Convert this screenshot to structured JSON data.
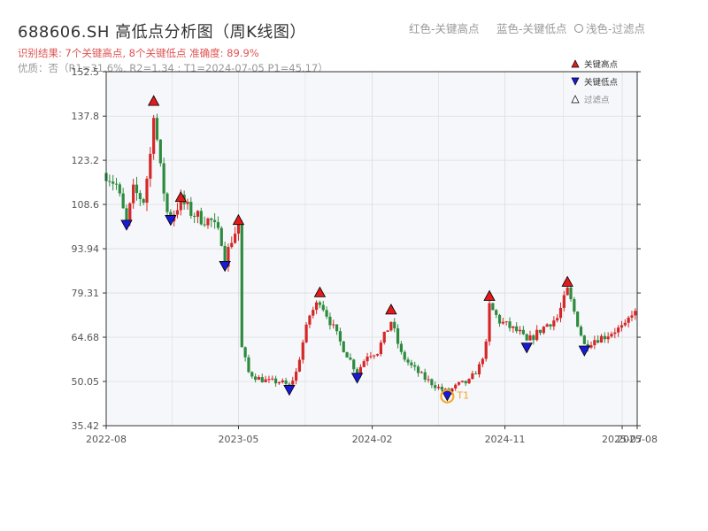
{
  "title": "688606.SH 高低点分析图（周K线图）",
  "result_line": "识别结果: 7个关键高点, 8个关键低点  准确度: 89.9%",
  "quality_line": "优质：否（R1=31.6%, R2=1.34 ; T1=2024-07-05 P1=45.17）",
  "top_legend": {
    "red": "红色-关键高点",
    "blue": "蓝色-关键低点",
    "light": "浅色-过滤点"
  },
  "colors": {
    "up": "#d62728",
    "down": "#2e8b3e",
    "high_marker": "#e31a1c",
    "low_marker": "#1a1ad6",
    "t1_ring": "#f5a623",
    "plot_bg": "#f5f7fa",
    "grid": "#dddddd"
  },
  "chart_data": {
    "type": "candlestick",
    "title": "688606.SH 高低点分析图（周K线图）",
    "x_ticks": [
      "2022-08",
      "2023-05",
      "2024-02",
      "2024-11",
      "2025-07",
      "2025-08"
    ],
    "x_tick_dates": [
      "2022-08-01",
      "2023-05-01",
      "2024-02-01",
      "2024-11-01",
      "2025-07-01",
      "2025-08-01"
    ],
    "x_range": [
      "2022-08-01",
      "2025-08-01"
    ],
    "y_ticks": [
      "35.42",
      "50.05",
      "64.68",
      "79.31",
      "93.94",
      "108.6",
      "123.2",
      "137.8",
      "152.5"
    ],
    "ylim": [
      35.42,
      152.5
    ],
    "legend": [
      {
        "label": "关键高点",
        "marker": "triangle-up",
        "color": "#e31a1c"
      },
      {
        "label": "关键低点",
        "marker": "triangle-down",
        "color": "#1a1ad6"
      },
      {
        "label": "过滤点",
        "marker": "triangle-up-open",
        "color": "#ffffff"
      }
    ],
    "legend_position": "top-right",
    "grid": true,
    "key_highs": [
      {
        "date": "2022-11-07",
        "value": 142.8
      },
      {
        "date": "2023-01-02",
        "value": 111.0
      },
      {
        "date": "2023-05-01",
        "value": 103.4
      },
      {
        "date": "2023-10-16",
        "value": 79.5
      },
      {
        "date": "2024-03-11",
        "value": 73.8
      },
      {
        "date": "2024-09-30",
        "value": 78.3
      },
      {
        "date": "2025-03-10",
        "value": 83.0
      }
    ],
    "key_lows": [
      {
        "date": "2022-09-12",
        "value": 101.6
      },
      {
        "date": "2022-12-12",
        "value": 103.2
      },
      {
        "date": "2023-04-03",
        "value": 88.0
      },
      {
        "date": "2023-08-14",
        "value": 47.0
      },
      {
        "date": "2024-01-01",
        "value": 51.0
      },
      {
        "date": "2024-07-05",
        "value": 45.17
      },
      {
        "date": "2024-12-16",
        "value": 61.0
      },
      {
        "date": "2025-04-14",
        "value": 60.0
      }
    ],
    "t1": {
      "label": "T1",
      "date": "2024-07-05",
      "value": 45.17
    },
    "price_path": [
      [
        "2022-08-01",
        119
      ],
      [
        "2022-08-22",
        115
      ],
      [
        "2022-09-12",
        102
      ],
      [
        "2022-09-26",
        113
      ],
      [
        "2022-10-17",
        110
      ],
      [
        "2022-10-31",
        125
      ],
      [
        "2022-11-07",
        140
      ],
      [
        "2022-11-21",
        120
      ],
      [
        "2022-12-05",
        106
      ],
      [
        "2022-12-12",
        104
      ],
      [
        "2023-01-02",
        110
      ],
      [
        "2023-01-23",
        106
      ],
      [
        "2023-02-13",
        104
      ],
      [
        "2023-03-06",
        103
      ],
      [
        "2023-03-27",
        97
      ],
      [
        "2023-04-03",
        90
      ],
      [
        "2023-04-17",
        97
      ],
      [
        "2023-05-01",
        102
      ],
      [
        "2023-05-08",
        61
      ],
      [
        "2023-05-22",
        53
      ],
      [
        "2023-06-12",
        51
      ],
      [
        "2023-07-03",
        50
      ],
      [
        "2023-07-24",
        50
      ],
      [
        "2023-08-14",
        48.5
      ],
      [
        "2023-08-28",
        53
      ],
      [
        "2023-09-11",
        63
      ],
      [
        "2023-09-25",
        72
      ],
      [
        "2023-10-16",
        77
      ],
      [
        "2023-11-06",
        70
      ],
      [
        "2023-11-27",
        63
      ],
      [
        "2023-12-18",
        57
      ],
      [
        "2024-01-01",
        53
      ],
      [
        "2024-01-22",
        59
      ],
      [
        "2024-02-12",
        60
      ],
      [
        "2024-03-11",
        70
      ],
      [
        "2024-04-01",
        59
      ],
      [
        "2024-04-22",
        55
      ],
      [
        "2024-05-20",
        51
      ],
      [
        "2024-06-17",
        48
      ],
      [
        "2024-07-05",
        46.5
      ],
      [
        "2024-07-29",
        49
      ],
      [
        "2024-08-19",
        50
      ],
      [
        "2024-09-09",
        55
      ],
      [
        "2024-09-23",
        62
      ],
      [
        "2024-09-30",
        75
      ],
      [
        "2024-10-21",
        70
      ],
      [
        "2024-11-11",
        68
      ],
      [
        "2024-12-02",
        66
      ],
      [
        "2024-12-16",
        63
      ],
      [
        "2025-01-06",
        66
      ],
      [
        "2025-01-27",
        69
      ],
      [
        "2025-02-17",
        71
      ],
      [
        "2025-03-10",
        80
      ],
      [
        "2025-03-24",
        73
      ],
      [
        "2025-04-14",
        62
      ],
      [
        "2025-05-05",
        64
      ],
      [
        "2025-05-26",
        65
      ],
      [
        "2025-06-16",
        67
      ],
      [
        "2025-07-07",
        68
      ],
      [
        "2025-07-21",
        73
      ],
      [
        "2025-08-01",
        72
      ]
    ]
  }
}
